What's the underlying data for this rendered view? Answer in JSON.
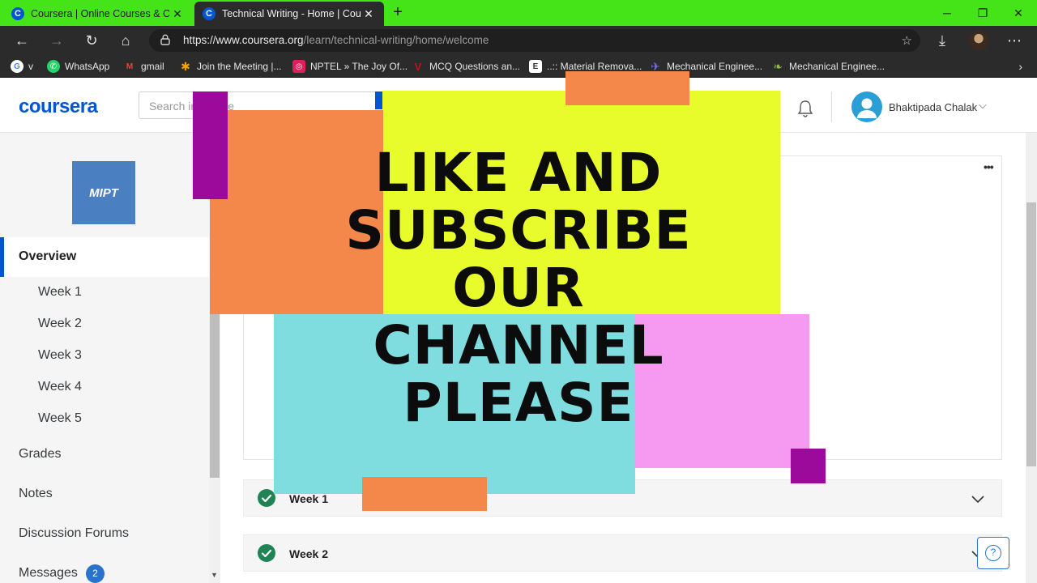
{
  "browser": {
    "tabs": [
      {
        "title": "Coursera | Online Courses & Cre",
        "icon": "coursera-favicon",
        "active": false
      },
      {
        "title": "Technical Writing - Home | Cours",
        "icon": "coursera-favicon",
        "active": true
      }
    ],
    "favicon_letter": "C",
    "tab_close_glyph": "✕",
    "new_tab_glyph": "+",
    "window_controls": {
      "minimize": "─",
      "restore": "❐",
      "close": "✕"
    },
    "nav": {
      "back": "←",
      "forward": "→",
      "refresh": "↻",
      "home": "⌂"
    },
    "url_host": "https://www.coursera.org",
    "url_path": "/learn/technical-writing/home/welcome",
    "toolbar_icons": {
      "favorites": "☆",
      "downloads": "⤓",
      "menu": "⋯"
    },
    "bookmarks": [
      {
        "label": "v",
        "icon": "google-icon",
        "icon_letter": "G",
        "color": "#ffffff"
      },
      {
        "label": "WhatsApp",
        "icon": "whatsapp-icon",
        "icon_letter": "✆",
        "color": "#25d366"
      },
      {
        "label": "gmail",
        "icon": "gmail-icon",
        "icon_letter": "M",
        "color": "#ea4335"
      },
      {
        "label": "Join the Meeting |...",
        "icon": "meeting-icon",
        "icon_letter": "✱",
        "color": "#f4a300"
      },
      {
        "label": "NPTEL » The Joy Of...",
        "icon": "nptel-icon",
        "icon_letter": "◎",
        "color": "#e01e5a"
      },
      {
        "label": "MCQ Questions an...",
        "icon": "mcq-icon",
        "icon_letter": "V",
        "color": "#c0141c"
      },
      {
        "label": "..:: Material Remova...",
        "icon": "material-icon",
        "icon_letter": "E",
        "color": "#ffffff"
      },
      {
        "label": "Mechanical Enginee...",
        "icon": "mech-icon-1",
        "icon_letter": "✈",
        "color": "#7b6cf6"
      },
      {
        "label": "Mechanical Enginee...",
        "icon": "mech-icon-2",
        "icon_letter": "❧",
        "color": "#8fbf3f"
      }
    ],
    "bookmarks_more": "›"
  },
  "header": {
    "logo": "coursera",
    "search_placeholder": "Search in course",
    "user_name": "Bhaktipada Chalak",
    "user_caret": "⌵"
  },
  "sidebar": {
    "institution_logo": "MIPT",
    "active_item": "Overview",
    "weeks": [
      "Week 1",
      "Week 2",
      "Week 3",
      "Week 4",
      "Week 5"
    ],
    "items": [
      "Grades",
      "Notes",
      "Discussion Forums",
      "Messages"
    ],
    "messages_badge": "2"
  },
  "main": {
    "more_glyph": "•••",
    "week_rows": [
      {
        "label": "Week 1",
        "completed": true
      },
      {
        "label": "Week 2",
        "completed": true
      }
    ],
    "help_glyph": "?"
  },
  "overlay": {
    "lines": [
      "LIKE AND",
      "SUBSCRIBE",
      "OUR",
      "CHANNEL",
      "PLEASE"
    ],
    "colors": {
      "yellow": "#e8fc2c",
      "orange": "#f4874a",
      "cyan": "#7fdde0",
      "pink": "#f59af0",
      "purple": "#9c0a9c"
    }
  },
  "colors": {
    "titlebar": "#44e419",
    "chrome_dark": "#2b2b2b",
    "brand_blue": "#0056d2",
    "check_green": "#1f8354"
  }
}
